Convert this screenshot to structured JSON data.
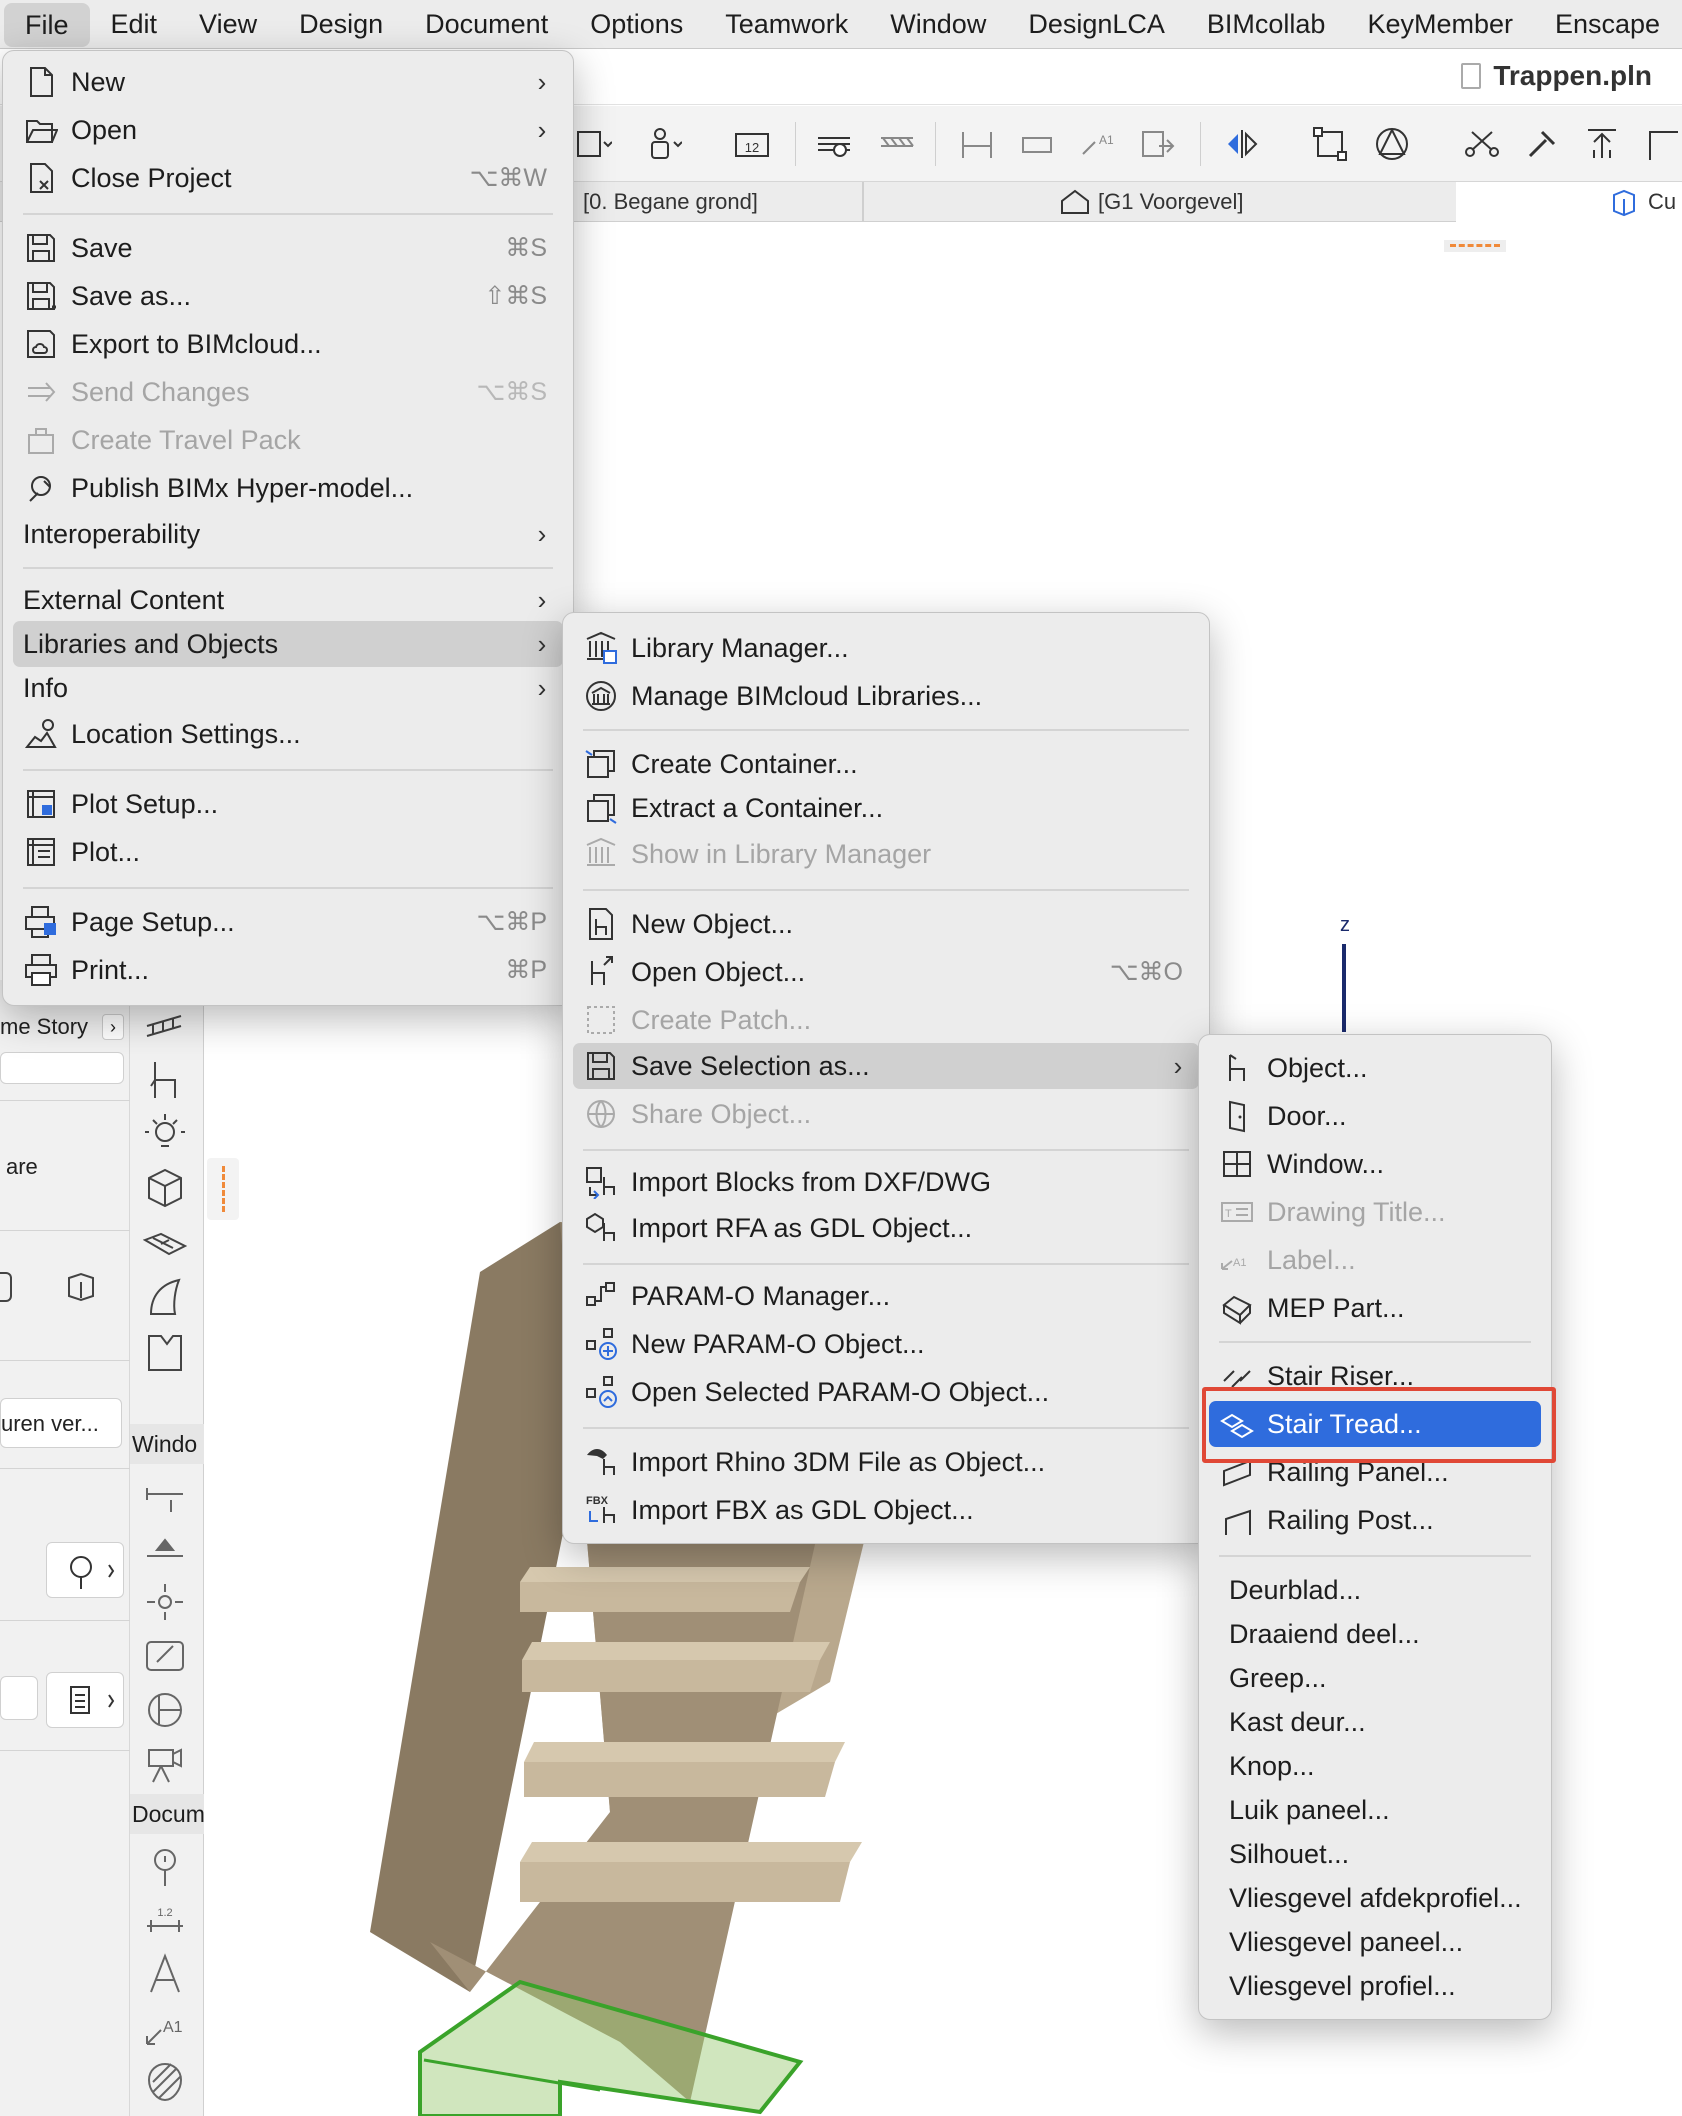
{
  "menubar": [
    "File",
    "Edit",
    "View",
    "Design",
    "Document",
    "Options",
    "Teamwork",
    "Window",
    "DesignLCA",
    "BIMcollab",
    "KeyMember",
    "Enscape"
  ],
  "window": {
    "title": "Trappen.pln"
  },
  "tabs": {
    "floor": "[0. Begane grond]",
    "elevation": "[G1 Voorgevel]",
    "third": "Cu"
  },
  "left_panel": {
    "story_label": "me Story",
    "are_label": "are",
    "layer_label": "uren ver...",
    "window_label": "Windo",
    "document_label": "Docum"
  },
  "axis": {
    "z": "z"
  },
  "file_menu": {
    "items": [
      {
        "label": "New",
        "icon": "new-document-icon",
        "submenu": true
      },
      {
        "label": "Open",
        "icon": "open-folder-icon",
        "submenu": true
      },
      {
        "label": "Close Project",
        "icon": "close-project-icon",
        "shortcut": "⌥⌘W"
      },
      {
        "label": "Save",
        "icon": "save-icon",
        "shortcut": "⌘S"
      },
      {
        "label": "Save as...",
        "icon": "save-as-icon",
        "shortcut": "⇧⌘S"
      },
      {
        "label": "Export to BIMcloud...",
        "icon": "export-bimcloud-icon"
      },
      {
        "label": "Send Changes",
        "icon": "send-changes-icon",
        "shortcut": "⌥⌘S",
        "disabled": true
      },
      {
        "label": "Create Travel Pack",
        "icon": "travel-pack-icon",
        "disabled": true
      },
      {
        "label": "Publish BIMx Hyper-model...",
        "icon": "bimx-icon"
      },
      {
        "label": "Interoperability",
        "submenu": true
      },
      {
        "label": "External Content",
        "submenu": true
      },
      {
        "label": "Libraries and Objects",
        "submenu": true,
        "highlighted": true
      },
      {
        "label": "Info",
        "submenu": true
      },
      {
        "label": "Location Settings...",
        "icon": "location-icon"
      },
      {
        "label": "Plot Setup...",
        "icon": "plot-setup-icon"
      },
      {
        "label": "Plot...",
        "icon": "plot-icon"
      },
      {
        "label": "Page Setup...",
        "icon": "page-setup-icon",
        "shortcut": "⌥⌘P"
      },
      {
        "label": "Print...",
        "icon": "print-icon",
        "shortcut": "⌘P"
      }
    ]
  },
  "libraries_menu": {
    "items": [
      {
        "label": "Library Manager...",
        "icon": "library-manager-icon"
      },
      {
        "label": "Manage BIMcloud Libraries...",
        "icon": "bimcloud-libraries-icon"
      },
      {
        "label": "Create Container...",
        "icon": "create-container-icon"
      },
      {
        "label": "Extract a Container...",
        "icon": "extract-container-icon"
      },
      {
        "label": "Show in Library Manager",
        "icon": "show-library-icon",
        "disabled": true
      },
      {
        "label": "New Object...",
        "icon": "new-object-icon"
      },
      {
        "label": "Open Object...",
        "icon": "open-object-icon",
        "shortcut": "⌥⌘O"
      },
      {
        "label": "Create Patch...",
        "icon": "create-patch-icon",
        "disabled": true
      },
      {
        "label": "Save Selection as...",
        "icon": "save-selection-icon",
        "submenu": true,
        "highlighted": true
      },
      {
        "label": "Share Object...",
        "icon": "share-object-icon",
        "disabled": true
      },
      {
        "label": "Import Blocks from DXF/DWG",
        "icon": "import-dxf-icon"
      },
      {
        "label": "Import RFA as GDL Object...",
        "icon": "import-rfa-icon"
      },
      {
        "label": "PARAM-O Manager...",
        "icon": "param-o-manager-icon"
      },
      {
        "label": "New PARAM-O Object...",
        "icon": "new-param-o-icon"
      },
      {
        "label": "Open Selected PARAM-O Object...",
        "icon": "open-param-o-icon"
      },
      {
        "label": "Import Rhino 3DM File as Object...",
        "icon": "import-rhino-icon"
      },
      {
        "label": "Import FBX as GDL Object...",
        "icon": "import-fbx-icon",
        "badge": "FBX"
      }
    ]
  },
  "save_selection_menu": {
    "items": [
      {
        "label": "Object...",
        "icon": "object-icon"
      },
      {
        "label": "Door...",
        "icon": "door-icon"
      },
      {
        "label": "Window...",
        "icon": "window-icon"
      },
      {
        "label": "Drawing Title...",
        "icon": "drawing-title-icon",
        "disabled": true
      },
      {
        "label": "Label...",
        "icon": "label-icon",
        "disabled": true
      },
      {
        "label": "MEP Part...",
        "icon": "mep-part-icon"
      },
      {
        "label": "Stair Riser...",
        "icon": "stair-riser-icon"
      },
      {
        "label": "Stair Tread...",
        "icon": "stair-tread-icon",
        "selected": true
      },
      {
        "label": "Railing Panel...",
        "icon": "railing-panel-icon"
      },
      {
        "label": "Railing Post...",
        "icon": "railing-post-icon"
      },
      {
        "label": "Deurblad..."
      },
      {
        "label": "Draaiend deel..."
      },
      {
        "label": "Greep..."
      },
      {
        "label": "Kast deur..."
      },
      {
        "label": "Knop..."
      },
      {
        "label": "Luik paneel..."
      },
      {
        "label": "Silhouet..."
      },
      {
        "label": "Vliesgevel afdekprofiel..."
      },
      {
        "label": "Vliesgevel paneel..."
      },
      {
        "label": "Vliesgevel profiel..."
      }
    ]
  },
  "colors": {
    "accent": "#2f6cdd",
    "annotation": "#e04836",
    "selection": "#3aa32a",
    "wood": "#9b8a72"
  }
}
